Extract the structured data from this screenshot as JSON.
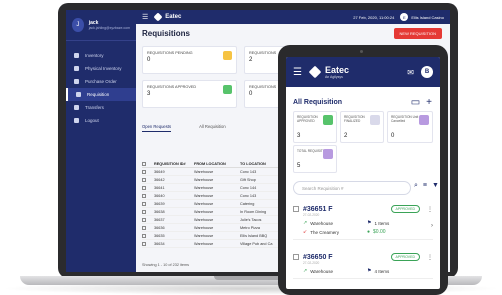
{
  "laptop": {
    "sidebar": {
      "user_name": "jack",
      "user_email": "jack.jahling@xyzbaze.com",
      "user_initial": "J",
      "items": [
        {
          "label": "Inventory"
        },
        {
          "label": "Physical Inventory"
        },
        {
          "label": "Purchase Order"
        },
        {
          "label": "Requisition"
        },
        {
          "label": "Transfers"
        },
        {
          "label": "Logout"
        }
      ]
    },
    "topbar": {
      "brand": "Eatec",
      "datetime": "27 Feb, 2020, 11:00:24",
      "location": "Ellis Island Casino",
      "user_initial": "E"
    },
    "page_title": "Requisitions",
    "new_button": "NEW REQUISITION",
    "cards": [
      {
        "label": "REQUISITIONS PENDING",
        "value": "0",
        "color": "#f6c343"
      },
      {
        "label": "REQUISITIONS",
        "value": "2",
        "color": "#9aa0b5"
      },
      {
        "label": "REQUISITIONS APPROVED",
        "value": "3",
        "color": "#57c36b"
      },
      {
        "label": "REQUISITIONS",
        "value": "0",
        "color": "#9aa0b5"
      }
    ],
    "tabs": [
      "Open Requests",
      "All Requisition"
    ],
    "table": {
      "headers": [
        "REQUISITION ID#",
        "FROM LOCATION",
        "TO LOCATION"
      ],
      "rows": [
        [
          "36649",
          "Warehouse",
          "Conc 143"
        ],
        [
          "36642",
          "Warehouse",
          "Gift Shop"
        ],
        [
          "36641",
          "Warehouse",
          "Conc 144"
        ],
        [
          "36640",
          "Warehouse",
          "Conc 143"
        ],
        [
          "36639",
          "Warehouse",
          "Catering"
        ],
        [
          "36638",
          "Warehouse",
          "In Room Dining"
        ],
        [
          "36637",
          "Warehouse",
          "Julie's Tacos"
        ],
        [
          "36636",
          "Warehouse",
          "Metro Pizza"
        ],
        [
          "36635",
          "Warehouse",
          "Ellis Island BBQ"
        ],
        [
          "36634",
          "Warehouse",
          "Village Pub and Ca"
        ]
      ]
    },
    "footer_info": "Showing 1 - 10 of 232 items",
    "pager": {
      "first": "First",
      "prev": "Previous",
      "current": "1"
    }
  },
  "tablet": {
    "brand": "Eatec",
    "brand_sub": "An Agilysys",
    "user_initial": "B",
    "title": "All Requisition",
    "cards": [
      {
        "label": "REQUISITION APPROVED",
        "value": "3",
        "color": "#57c36b"
      },
      {
        "label": "REQUISITION FINALIZED",
        "value": "2",
        "color": "#d9d9ea"
      },
      {
        "label": "REQUISITION Unit Cancelled",
        "value": "0",
        "color": "#b89ae0"
      },
      {
        "label": "TOTAL REQUISITION",
        "value": "5",
        "color": "#b89ae0"
      }
    ],
    "search_placeholder": "Search Requisition #",
    "requests": [
      {
        "id": "#36651 F",
        "date": "27-02-2020",
        "status": "APPROVED",
        "from": "Warehouse",
        "to": "The Creamery",
        "items": "1 Items",
        "cost": "$0.00"
      },
      {
        "id": "#36650 F",
        "date": "27-02-2020",
        "status": "APPROVED",
        "from": "Warehouse",
        "items": "4 Items"
      }
    ]
  }
}
